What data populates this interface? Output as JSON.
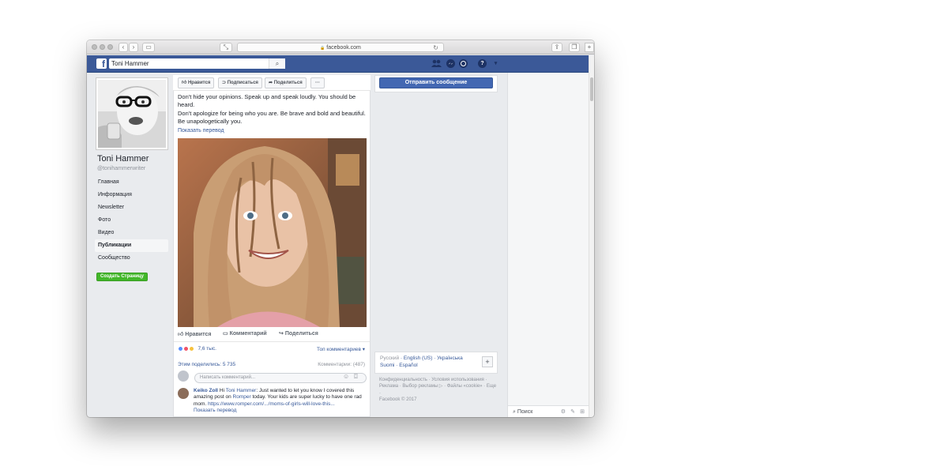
{
  "browser": {
    "url": "facebook.com",
    "lock_glyph": "🔒",
    "reload_glyph": "↻"
  },
  "topbar": {
    "search_value": "Toni Hammer",
    "logo_letter": "f",
    "search_icon": "⌕",
    "help_glyph": "?",
    "menu_glyph": "▾"
  },
  "profile": {
    "name": "Toni Hammer",
    "handle": "@tonihammerwriter"
  },
  "nav": {
    "items": [
      "Главная",
      "Информация",
      "Newsletter",
      "Фото",
      "Видео",
      "Публикации",
      "Сообщество"
    ],
    "create_page": "Создать Страницу"
  },
  "page_actions": {
    "like": "Нравится",
    "follow": "Подписаться",
    "share": "Поделиться",
    "more": "···"
  },
  "post": {
    "line1": "Don't hide your opinions. Speak up and speak loudly. You should be heard.",
    "line2": "Don't apologize for being who you are. Be brave and bold and beautiful. Be unapologetically you.",
    "translate": "Показать перевод",
    "like": "Нравится",
    "comment": "Комментарий",
    "share": "Поделиться",
    "reactions_count": "7,6 тыс.",
    "top_comments": "Топ комментариев ▾",
    "shares": "Этим поделились: 5 735",
    "comments_count": "Комментарии: (487)",
    "comment_placeholder": "Написать комментарий..."
  },
  "comment": {
    "author": "Keiko Zoll",
    "text_before_mention": " Hi ",
    "mention": "Toni Hammer",
    "text1": ": Just wanted to let you know I covered this amazing post on ",
    "source": "Romper",
    "text2": " today. Your kids are super lucky to have one rad mom. ",
    "url": "https://www.romper.com/.../moms-of-girls-will-love-this...",
    "translate": "Показать перевод"
  },
  "sidebar_right": {
    "send_message": "Отправить сообщение",
    "languages": [
      "Русский",
      "English (US)",
      "Українська",
      "Suomi",
      "Español"
    ],
    "lang_add": "+",
    "footer": "Конфиденциальность · Условия использования · Реклама · Выбор рекламы ▷ · Файлы «cookie» · Еще ·",
    "copyright": "Facebook © 2017"
  },
  "chat": {
    "search": "Поиск"
  },
  "colors": {
    "facebook_blue": "#3b5998",
    "button_blue": "#4267b2",
    "link": "#365899",
    "create_green": "#42b72a"
  }
}
